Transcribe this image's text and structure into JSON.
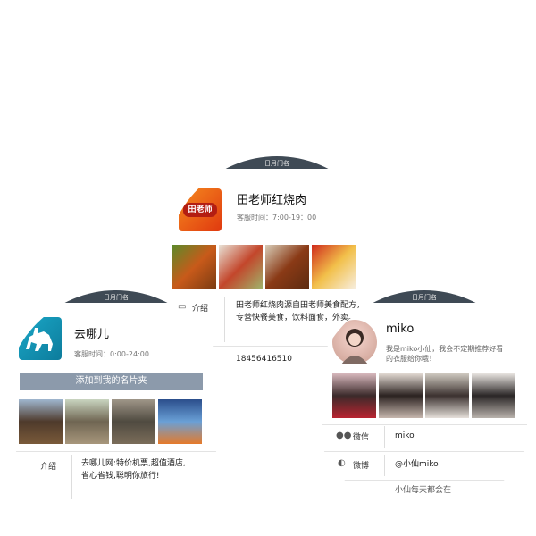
{
  "cards": {
    "top": {
      "header_text": "日月门名",
      "title": "田老师红烧肉",
      "hours": "客服时间：7:00-19：00",
      "logo_text": "田老师",
      "intro_label": "介绍",
      "intro_text": "田老师红烧肉源自田老师美食配方，专营快餐美食，饮料面食，外卖。",
      "phone": "18456416510"
    },
    "left": {
      "header_text": "日月门名",
      "title": "去哪儿",
      "hours": "客服时间：0:00-24:00",
      "add_button": "添加到我的名片夹",
      "intro_label": "介绍",
      "intro_text": "去哪儿网:特价机票,超值酒店,省心省钱,聪明你旅行!"
    },
    "right": {
      "header_text": "日月门名",
      "title": "miko",
      "desc": "我是miko小仙，我会不定期推荐好看的衣服给你哦！",
      "wechat_label": "微信",
      "wechat_value": "miko",
      "weibo_label": "微博",
      "weibo_value": "@小仙miko",
      "extra_text": "小仙每天都会在"
    }
  }
}
